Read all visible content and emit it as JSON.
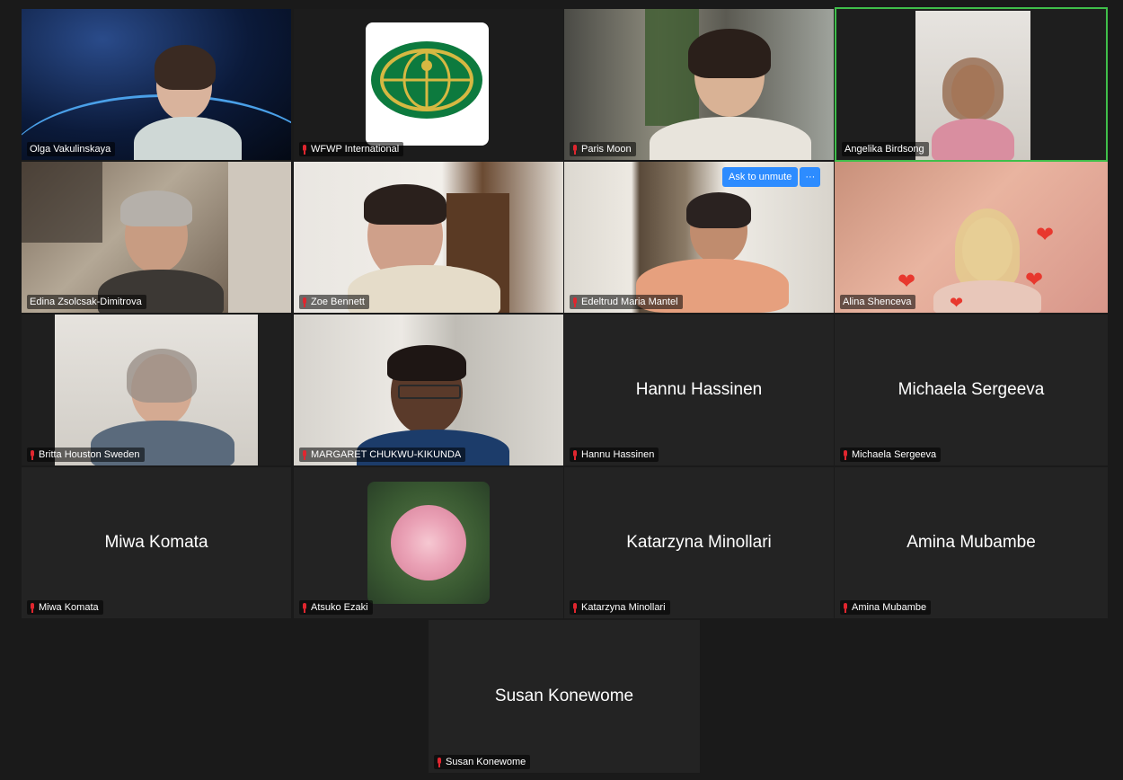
{
  "participants": [
    {
      "name": "Olga Vakulinskaya",
      "center": ""
    },
    {
      "name": "WFWP International",
      "center": ""
    },
    {
      "name": "Paris Moon",
      "center": ""
    },
    {
      "name": "Angelika Birdsong",
      "center": ""
    },
    {
      "name": "Edina Zsolcsak-Dimitrova",
      "center": ""
    },
    {
      "name": "Zoe Bennett",
      "center": ""
    },
    {
      "name": "Edeltrud Maria Mantel",
      "center": ""
    },
    {
      "name": "Alina Shenceva",
      "center": ""
    },
    {
      "name": "Britta Houston Sweden",
      "center": ""
    },
    {
      "name": "MARGARET CHUKWU-KIKUNDA",
      "center": ""
    },
    {
      "name": "Hannu Hassinen",
      "center": "Hannu Hassinen"
    },
    {
      "name": "Michaela Sergeeva",
      "center": "Michaela Sergeeva"
    },
    {
      "name": "Miwa Komata",
      "center": "Miwa Komata"
    },
    {
      "name": "Atsuko Ezaki",
      "center": ""
    },
    {
      "name": "Katarzyna Minollari",
      "center": "Katarzyna Minollari"
    },
    {
      "name": "Amina Mubambe",
      "center": "Amina Mubambe"
    },
    {
      "name": "Susan Konewome",
      "center": "Susan Konewome"
    }
  ],
  "ask_to_unmute": {
    "label": "Ask to unmute",
    "more": "···"
  },
  "icons": {
    "mic": "mic-muted-icon",
    "heart": "heart-icon"
  },
  "colors": {
    "active_speaker_border": "#3fbf4a",
    "muted_mic": "#e0262f",
    "button": "#2d8cff"
  }
}
